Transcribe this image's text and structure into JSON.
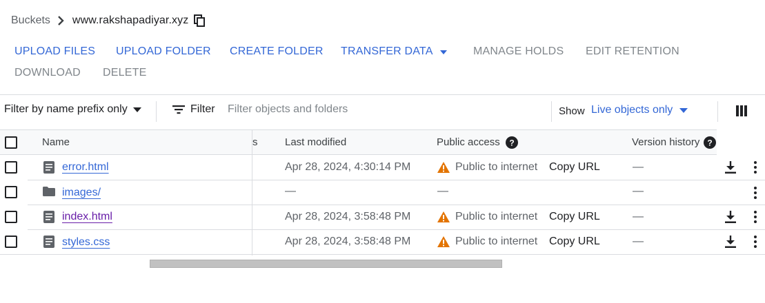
{
  "breadcrumb": {
    "root": "Buckets",
    "current": "www.rakshapadiyar.xyz"
  },
  "actions": {
    "upload_files": "UPLOAD FILES",
    "upload_folder": "UPLOAD FOLDER",
    "create_folder": "CREATE FOLDER",
    "transfer_data": "TRANSFER DATA",
    "manage_holds": "MANAGE HOLDS",
    "edit_retention": "EDIT RETENTION",
    "download": "DOWNLOAD",
    "delete": "DELETE"
  },
  "filter": {
    "prefix_mode": "Filter by name prefix only",
    "filter_label": "Filter",
    "placeholder": "Filter objects and folders",
    "show_label": "Show",
    "show_value": "Live objects only"
  },
  "table": {
    "columns": {
      "name": "Name",
      "truncated": "s",
      "last_modified": "Last modified",
      "public_access": "Public access",
      "version_history": "Version history"
    },
    "rows": [
      {
        "name": "error.html",
        "type": "file",
        "last_modified": "Apr 28, 2024, 4:30:14 PM",
        "public_access": "Public to internet",
        "copy_url": "Copy URL",
        "version_history": "—"
      },
      {
        "name": "images/",
        "type": "folder",
        "last_modified": "—",
        "public_access": "—",
        "copy_url": "",
        "version_history": "—"
      },
      {
        "name": "index.html",
        "type": "file",
        "last_modified": "Apr 28, 2024, 3:58:48 PM",
        "public_access": "Public to internet",
        "copy_url": "Copy URL",
        "version_history": "—"
      },
      {
        "name": "styles.css",
        "type": "file",
        "last_modified": "Apr 28, 2024, 3:58:48 PM",
        "public_access": "Public to internet",
        "copy_url": "Copy URL",
        "version_history": "—"
      }
    ]
  },
  "colors": {
    "accent": "#3367d6",
    "visited_link": "#681da8",
    "warning": "#e37400",
    "disabled": "#80868b",
    "divider": "#dadce0"
  }
}
